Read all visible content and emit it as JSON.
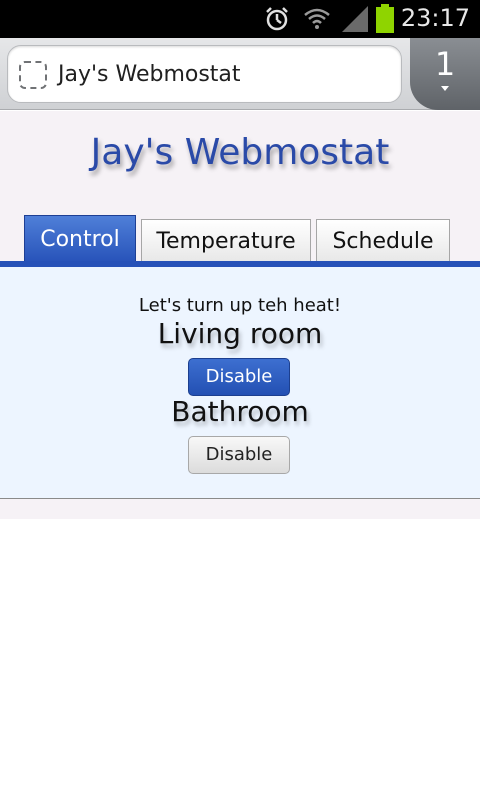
{
  "status_bar": {
    "time": "23:17",
    "icons": [
      "alarm-icon",
      "wifi-icon",
      "signal-icon",
      "battery-icon"
    ]
  },
  "browser": {
    "url_text": "Jay's Webmostat",
    "tab_count": "1"
  },
  "page": {
    "title": "Jay's Webmostat",
    "tabs": [
      {
        "label": "Control",
        "active": true
      },
      {
        "label": "Temperature",
        "active": false
      },
      {
        "label": "Schedule",
        "active": false
      }
    ],
    "control": {
      "intro": "Let's turn up teh heat!",
      "rooms": [
        {
          "name": "Living room",
          "button_label": "Disable",
          "state": "highlighted"
        },
        {
          "name": "Bathroom",
          "button_label": "Disable",
          "state": "normal"
        }
      ]
    }
  },
  "colors": {
    "accent_blue": "#2651b8",
    "title_blue": "#2a4aa8",
    "panel_bg": "#edf5ff",
    "page_bg": "#f6f2f6"
  }
}
